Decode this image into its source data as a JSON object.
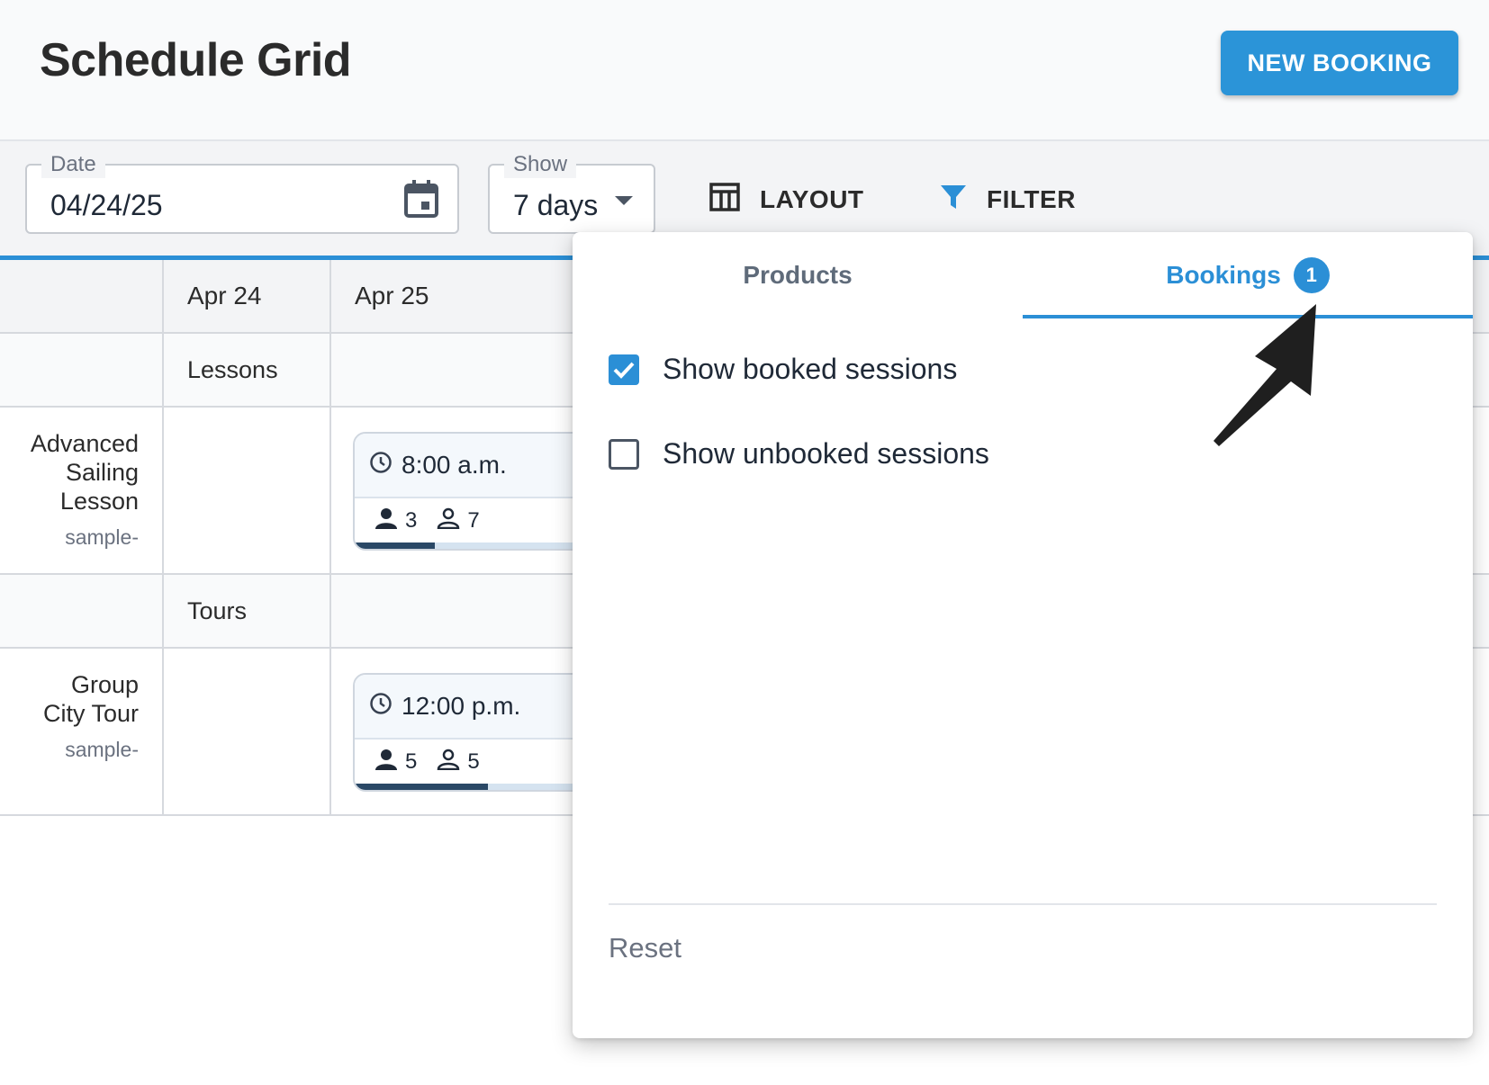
{
  "header": {
    "title": "Schedule Grid",
    "new_booking_label": "NEW BOOKING"
  },
  "toolbar": {
    "date_label": "Date",
    "date_value": "04/24/25",
    "show_label": "Show",
    "show_value": "7 days",
    "layout_label": "LAYOUT",
    "filter_label": "FILTER"
  },
  "grid": {
    "dates": [
      "Apr 24",
      "Apr 25"
    ],
    "categories": [
      {
        "name": "Lessons",
        "product": {
          "name_lines": [
            "Advanced",
            "Sailing",
            "Lesson"
          ],
          "sub": "sample-"
        },
        "session": {
          "time": "8:00 a.m.",
          "booked": "3",
          "available": "7",
          "fill_fraction": 0.3
        }
      },
      {
        "name": "Tours",
        "product": {
          "name_lines": [
            "Group",
            "City Tour"
          ],
          "sub": "sample-"
        },
        "session": {
          "time": "12:00 p.m.",
          "booked": "5",
          "available": "5",
          "fill_fraction": 0.5
        }
      }
    ]
  },
  "filter_popover": {
    "tabs": [
      {
        "label": "Products",
        "active": false
      },
      {
        "label": "Bookings",
        "active": true,
        "badge": "1"
      }
    ],
    "options": [
      {
        "label": "Show booked sessions",
        "checked": true
      },
      {
        "label": "Show unbooked sessions",
        "checked": false
      }
    ],
    "reset_label": "Reset"
  },
  "colors": {
    "accent": "#2b8fd6",
    "button": "#2b94d8",
    "capacity_fill": "#2a4866"
  }
}
